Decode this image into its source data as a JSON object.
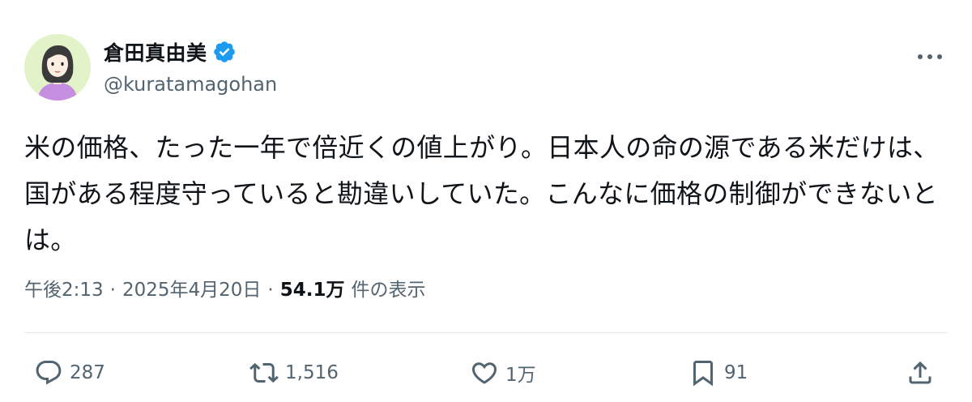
{
  "user": {
    "display_name": "倉田真由美",
    "handle": "@kuratamagohan",
    "verified": true,
    "verified_color": "#1d9bf0"
  },
  "tweet": {
    "text": "米の価格、たった一年で倍近くの値上がり。日本人の命の源である米だけは、国がある程度守っていると勘違いしていた。こんなに価格の制御ができないとは。",
    "time": "午後2:13",
    "separator": "·",
    "date": "2025年4月20日",
    "views_count": "54.1万",
    "views_label": "件の表示"
  },
  "actions": {
    "reply_count": "287",
    "retweet_count": "1,516",
    "like_count": "1万",
    "bookmark_count": "91"
  },
  "icons": {
    "more": "more-horizontal-icon",
    "reply": "reply-bubble-icon",
    "retweet": "retweet-arrows-icon",
    "like": "heart-icon",
    "bookmark": "bookmark-icon",
    "share": "share-upload-icon"
  },
  "colors": {
    "text_primary": "#0f1419",
    "text_secondary": "#536471",
    "divider": "#e7e9ea",
    "accent": "#1d9bf0"
  }
}
